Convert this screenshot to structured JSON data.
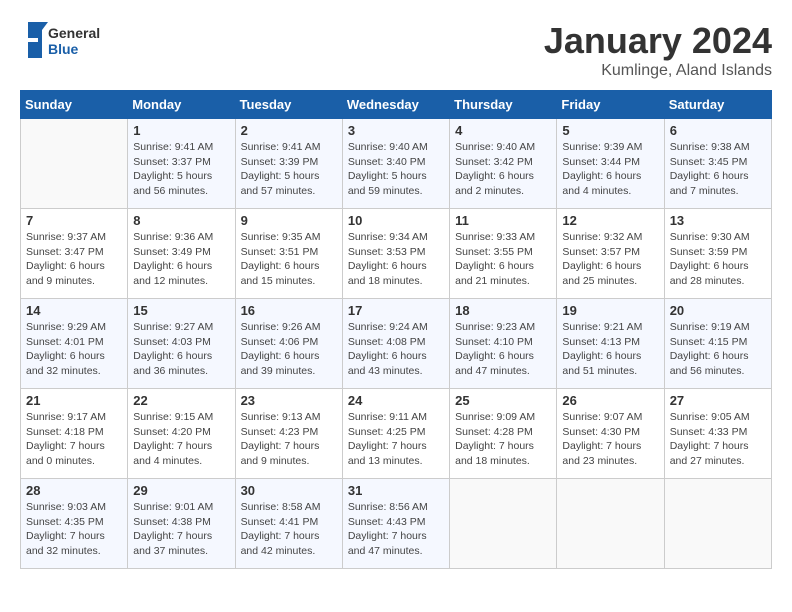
{
  "header": {
    "logo_general": "General",
    "logo_blue": "Blue",
    "month_title": "January 2024",
    "location": "Kumlinge, Aland Islands"
  },
  "weekdays": [
    "Sunday",
    "Monday",
    "Tuesday",
    "Wednesday",
    "Thursday",
    "Friday",
    "Saturday"
  ],
  "weeks": [
    [
      {
        "day": "",
        "info": ""
      },
      {
        "day": "1",
        "info": "Sunrise: 9:41 AM\nSunset: 3:37 PM\nDaylight: 5 hours\nand 56 minutes."
      },
      {
        "day": "2",
        "info": "Sunrise: 9:41 AM\nSunset: 3:39 PM\nDaylight: 5 hours\nand 57 minutes."
      },
      {
        "day": "3",
        "info": "Sunrise: 9:40 AM\nSunset: 3:40 PM\nDaylight: 5 hours\nand 59 minutes."
      },
      {
        "day": "4",
        "info": "Sunrise: 9:40 AM\nSunset: 3:42 PM\nDaylight: 6 hours\nand 2 minutes."
      },
      {
        "day": "5",
        "info": "Sunrise: 9:39 AM\nSunset: 3:44 PM\nDaylight: 6 hours\nand 4 minutes."
      },
      {
        "day": "6",
        "info": "Sunrise: 9:38 AM\nSunset: 3:45 PM\nDaylight: 6 hours\nand 7 minutes."
      }
    ],
    [
      {
        "day": "7",
        "info": "Sunrise: 9:37 AM\nSunset: 3:47 PM\nDaylight: 6 hours\nand 9 minutes."
      },
      {
        "day": "8",
        "info": "Sunrise: 9:36 AM\nSunset: 3:49 PM\nDaylight: 6 hours\nand 12 minutes."
      },
      {
        "day": "9",
        "info": "Sunrise: 9:35 AM\nSunset: 3:51 PM\nDaylight: 6 hours\nand 15 minutes."
      },
      {
        "day": "10",
        "info": "Sunrise: 9:34 AM\nSunset: 3:53 PM\nDaylight: 6 hours\nand 18 minutes."
      },
      {
        "day": "11",
        "info": "Sunrise: 9:33 AM\nSunset: 3:55 PM\nDaylight: 6 hours\nand 21 minutes."
      },
      {
        "day": "12",
        "info": "Sunrise: 9:32 AM\nSunset: 3:57 PM\nDaylight: 6 hours\nand 25 minutes."
      },
      {
        "day": "13",
        "info": "Sunrise: 9:30 AM\nSunset: 3:59 PM\nDaylight: 6 hours\nand 28 minutes."
      }
    ],
    [
      {
        "day": "14",
        "info": "Sunrise: 9:29 AM\nSunset: 4:01 PM\nDaylight: 6 hours\nand 32 minutes."
      },
      {
        "day": "15",
        "info": "Sunrise: 9:27 AM\nSunset: 4:03 PM\nDaylight: 6 hours\nand 36 minutes."
      },
      {
        "day": "16",
        "info": "Sunrise: 9:26 AM\nSunset: 4:06 PM\nDaylight: 6 hours\nand 39 minutes."
      },
      {
        "day": "17",
        "info": "Sunrise: 9:24 AM\nSunset: 4:08 PM\nDaylight: 6 hours\nand 43 minutes."
      },
      {
        "day": "18",
        "info": "Sunrise: 9:23 AM\nSunset: 4:10 PM\nDaylight: 6 hours\nand 47 minutes."
      },
      {
        "day": "19",
        "info": "Sunrise: 9:21 AM\nSunset: 4:13 PM\nDaylight: 6 hours\nand 51 minutes."
      },
      {
        "day": "20",
        "info": "Sunrise: 9:19 AM\nSunset: 4:15 PM\nDaylight: 6 hours\nand 56 minutes."
      }
    ],
    [
      {
        "day": "21",
        "info": "Sunrise: 9:17 AM\nSunset: 4:18 PM\nDaylight: 7 hours\nand 0 minutes."
      },
      {
        "day": "22",
        "info": "Sunrise: 9:15 AM\nSunset: 4:20 PM\nDaylight: 7 hours\nand 4 minutes."
      },
      {
        "day": "23",
        "info": "Sunrise: 9:13 AM\nSunset: 4:23 PM\nDaylight: 7 hours\nand 9 minutes."
      },
      {
        "day": "24",
        "info": "Sunrise: 9:11 AM\nSunset: 4:25 PM\nDaylight: 7 hours\nand 13 minutes."
      },
      {
        "day": "25",
        "info": "Sunrise: 9:09 AM\nSunset: 4:28 PM\nDaylight: 7 hours\nand 18 minutes."
      },
      {
        "day": "26",
        "info": "Sunrise: 9:07 AM\nSunset: 4:30 PM\nDaylight: 7 hours\nand 23 minutes."
      },
      {
        "day": "27",
        "info": "Sunrise: 9:05 AM\nSunset: 4:33 PM\nDaylight: 7 hours\nand 27 minutes."
      }
    ],
    [
      {
        "day": "28",
        "info": "Sunrise: 9:03 AM\nSunset: 4:35 PM\nDaylight: 7 hours\nand 32 minutes."
      },
      {
        "day": "29",
        "info": "Sunrise: 9:01 AM\nSunset: 4:38 PM\nDaylight: 7 hours\nand 37 minutes."
      },
      {
        "day": "30",
        "info": "Sunrise: 8:58 AM\nSunset: 4:41 PM\nDaylight: 7 hours\nand 42 minutes."
      },
      {
        "day": "31",
        "info": "Sunrise: 8:56 AM\nSunset: 4:43 PM\nDaylight: 7 hours\nand 47 minutes."
      },
      {
        "day": "",
        "info": ""
      },
      {
        "day": "",
        "info": ""
      },
      {
        "day": "",
        "info": ""
      }
    ]
  ]
}
